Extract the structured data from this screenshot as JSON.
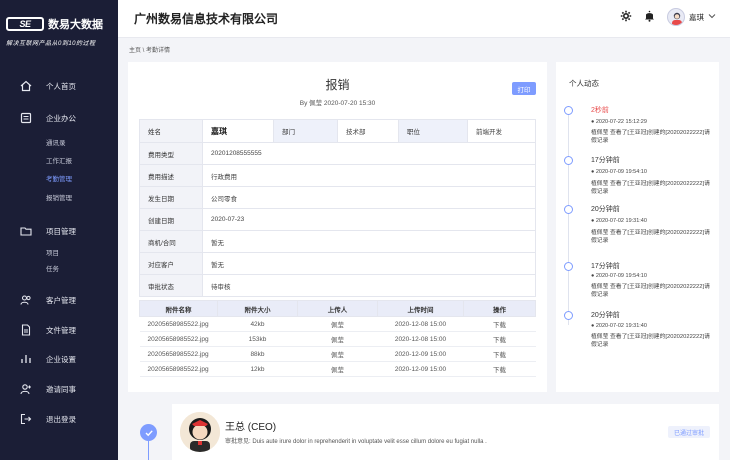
{
  "brand": {
    "logo": "SE",
    "name": "数易大数据",
    "slogan": "解决互联网产品从0到10的过程"
  },
  "nav": {
    "home": "个人首页",
    "office": "企业办公",
    "office_sub": [
      "通讯录",
      "工作汇报",
      "考勤管理",
      "报销管理"
    ],
    "project": "项目管理",
    "project_sub": [
      "项目",
      "任务"
    ],
    "customer": "客户管理",
    "files": "文件管理",
    "settings": "企业设置",
    "invite": "邀请同事",
    "logout": "退出登录"
  },
  "header": {
    "company": "广州数易信息技术有限公司",
    "user": "嘉琪"
  },
  "breadcrumb": "主页 \\ 考勤详情",
  "doc": {
    "title": "报销",
    "meta": "By  佩莹     2020-07-20 15:30",
    "print": "打印",
    "info": {
      "name_label": "姓名",
      "name": "嘉琪",
      "dept_label": "部门",
      "dept": "技术部",
      "pos_label": "职位",
      "pos": "前端开发",
      "rows": [
        {
          "label": "费用类型",
          "value": "20201208555555"
        },
        {
          "label": "费用描述",
          "value": "行政费用"
        },
        {
          "label": "发生日期",
          "value": "公司零食"
        },
        {
          "label": "创建日期",
          "value": "2020-07-23"
        },
        {
          "label": "商机/合同",
          "value": "暂无"
        },
        {
          "label": "对应客户",
          "value": "暂无"
        },
        {
          "label": "审批状态",
          "value": "待审核"
        }
      ]
    },
    "attachments": {
      "headers": [
        "附件名称",
        "附件大小",
        "上传人",
        "上传时间",
        "操作"
      ],
      "rows": [
        [
          "20205658985522.jpg",
          "42kb",
          "佩莹",
          "2020-12-08  15:00",
          "下载"
        ],
        [
          "20205658985522.jpg",
          "153kb",
          "佩莹",
          "2020-12-08  15:00",
          "下载"
        ],
        [
          "20205658985522.jpg",
          "88kb",
          "佩莹",
          "2020-12-09  15:00",
          "下载"
        ],
        [
          "20205658985522.jpg",
          "12kb",
          "佩莹",
          "2020-12-09  15:00",
          "下载"
        ]
      ]
    }
  },
  "activity": {
    "title": "个人动态",
    "items": [
      {
        "ago": "2秒前",
        "date": "● 2020-07-22  15:12:29",
        "text": "植佩莹 查看了[王亚冠]创建的[20202022222]请假记录"
      },
      {
        "ago": "17分钟前",
        "date": "● 2020-07-09  19:54:10",
        "text": "植佩莹 查看了[王亚冠]创建的[20202022222]请假记录"
      },
      {
        "ago": "20分钟前",
        "date": "● 2020-07-02  19:31:40",
        "text": "植佩莹 查看了[王亚冠]创建的[20202022222]请假记录"
      },
      {
        "ago": "17分钟前",
        "date": "● 2020-07-09  19:54:10",
        "text": "植佩莹 查看了[王亚冠]创建的[20202022222]请假记录"
      },
      {
        "ago": "20分钟前",
        "date": "● 2020-07-02  19:31:40",
        "text": "植佩莹 查看了[王亚冠]创建的[20202022222]请假记录"
      }
    ]
  },
  "approval": {
    "name": "王总 (CEO)",
    "comment": "审批意见: Duis aute irure dolor in reprehenderit in voluptate velit esse cillum dolore eu fugiat nulla .",
    "badge": "已通过审批"
  },
  "colors": {
    "sidebar": "#1b1e36",
    "accent": "#7e9cff",
    "alert": "#e84a4a"
  }
}
